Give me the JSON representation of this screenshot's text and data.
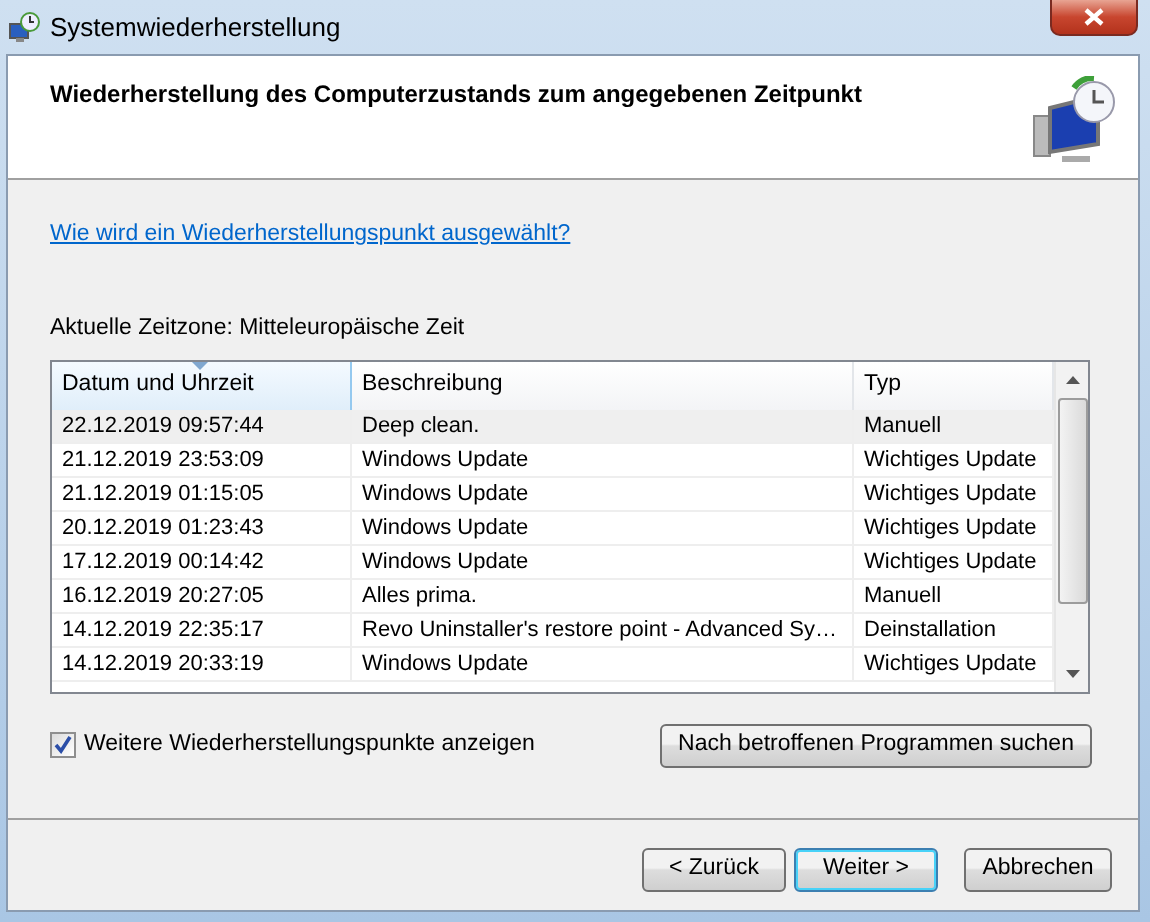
{
  "window": {
    "title": "Systemwiederherstellung"
  },
  "heading": "Wiederherstellung des Computerzustands zum angegebenen Zeitpunkt",
  "help_link": "Wie wird ein Wiederherstellungspunkt ausgewählt?",
  "timezone": "Aktuelle Zeitzone: Mitteleuropäische Zeit",
  "table": {
    "columns": [
      {
        "label": "Datum und Uhrzeit",
        "sorted": true
      },
      {
        "label": "Beschreibung",
        "sorted": false
      },
      {
        "label": "Typ",
        "sorted": false
      }
    ],
    "rows": [
      {
        "date": "22.12.2019 09:57:44",
        "description": "Deep clean.",
        "type": "Manuell",
        "selected": true
      },
      {
        "date": "21.12.2019 23:53:09",
        "description": "Windows Update",
        "type": "Wichtiges Update",
        "selected": false
      },
      {
        "date": "21.12.2019 01:15:05",
        "description": "Windows Update",
        "type": "Wichtiges Update",
        "selected": false
      },
      {
        "date": "20.12.2019 01:23:43",
        "description": "Windows Update",
        "type": "Wichtiges Update",
        "selected": false
      },
      {
        "date": "17.12.2019 00:14:42",
        "description": "Windows Update",
        "type": "Wichtiges Update",
        "selected": false
      },
      {
        "date": "16.12.2019 20:27:05",
        "description": "Alles prima.",
        "type": "Manuell",
        "selected": false
      },
      {
        "date": "14.12.2019 22:35:17",
        "description": "Revo Uninstaller's restore point - Advanced Sy…",
        "type": "Deinstallation",
        "selected": false
      },
      {
        "date": "14.12.2019 20:33:19",
        "description": "Windows Update",
        "type": "Wichtiges Update",
        "selected": false
      }
    ]
  },
  "show_more": {
    "label": "Weitere Wiederherstellungspunkte anzeigen",
    "checked": true
  },
  "affected_button": "Nach betroffenen Programmen suchen",
  "buttons": [
    {
      "label": "< Zurück",
      "default": false
    },
    {
      "label": "Weiter >",
      "default": true
    },
    {
      "label": "Abbrechen",
      "default": false
    }
  ]
}
